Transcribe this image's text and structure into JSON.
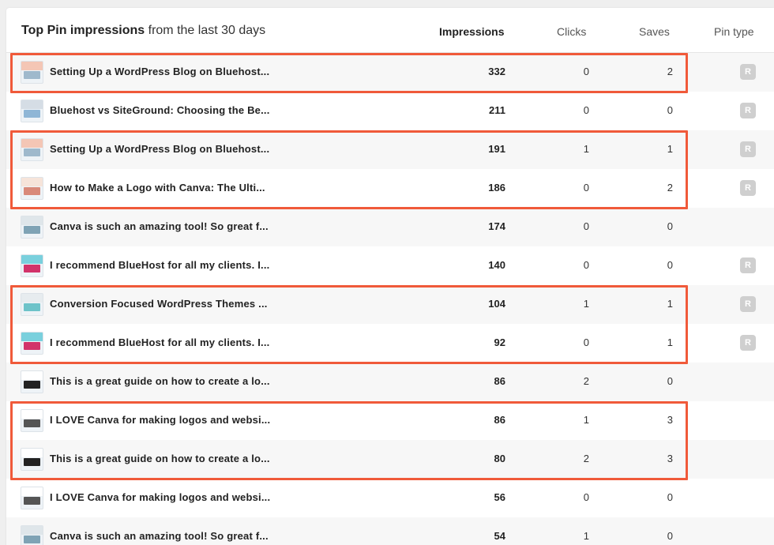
{
  "header": {
    "title_bold": "Top Pin impressions",
    "title_rest": "from the last 30 days",
    "col_impressions": "Impressions",
    "col_clicks": "Clicks",
    "col_saves": "Saves",
    "col_pin_type": "Pin type"
  },
  "colors": {
    "highlight": "#f05a3a",
    "badge": "#cfcfcf"
  },
  "rows": [
    {
      "title": "Setting Up a WordPress Blog on Bluehost...",
      "impressions": "332",
      "clicks": "0",
      "saves": "2",
      "pin_type": "R",
      "thumb": "wordpress-thumb"
    },
    {
      "title": "Bluehost vs SiteGround: Choosing the Be...",
      "impressions": "211",
      "clicks": "0",
      "saves": "0",
      "pin_type": "R",
      "thumb": "bluehost-thumb"
    },
    {
      "title": "Setting Up a WordPress Blog on Bluehost...",
      "impressions": "191",
      "clicks": "1",
      "saves": "1",
      "pin_type": "R",
      "thumb": "wordpress-thumb"
    },
    {
      "title": "How to Make a Logo with Canva: The Ulti...",
      "impressions": "186",
      "clicks": "0",
      "saves": "2",
      "pin_type": "R",
      "thumb": "canva-logo-thumb"
    },
    {
      "title": "Canva is such an amazing tool! So great f...",
      "impressions": "174",
      "clicks": "0",
      "saves": "0",
      "pin_type": "",
      "thumb": "canva-thumb"
    },
    {
      "title": "I recommend BlueHost for all my clients. I...",
      "impressions": "140",
      "clicks": "0",
      "saves": "0",
      "pin_type": "R",
      "thumb": "bluehost-pink-thumb"
    },
    {
      "title": "Conversion Focused WordPress Themes ...",
      "impressions": "104",
      "clicks": "1",
      "saves": "1",
      "pin_type": "R",
      "thumb": "themes-thumb"
    },
    {
      "title": "I recommend BlueHost for all my clients. I...",
      "impressions": "92",
      "clicks": "0",
      "saves": "1",
      "pin_type": "R",
      "thumb": "bluehost-pink-thumb"
    },
    {
      "title": "This is a great guide on how to create a lo...",
      "impressions": "86",
      "clicks": "2",
      "saves": "0",
      "pin_type": "",
      "thumb": "laptop-thumb"
    },
    {
      "title": "I LOVE Canva for making logos and websi...",
      "impressions": "86",
      "clicks": "1",
      "saves": "3",
      "pin_type": "",
      "thumb": "laptop-white-thumb"
    },
    {
      "title": "This is a great guide on how to create a lo...",
      "impressions": "80",
      "clicks": "2",
      "saves": "3",
      "pin_type": "",
      "thumb": "laptop-thumb"
    },
    {
      "title": "I LOVE Canva for making logos and websi...",
      "impressions": "56",
      "clicks": "0",
      "saves": "0",
      "pin_type": "",
      "thumb": "laptop-white-thumb"
    },
    {
      "title": "Canva is such an amazing tool! So great f...",
      "impressions": "54",
      "clicks": "1",
      "saves": "0",
      "pin_type": "",
      "thumb": "canva-thumb"
    }
  ],
  "highlight_groups": [
    [
      0
    ],
    [
      2,
      3
    ],
    [
      6,
      7
    ],
    [
      9,
      10
    ]
  ]
}
